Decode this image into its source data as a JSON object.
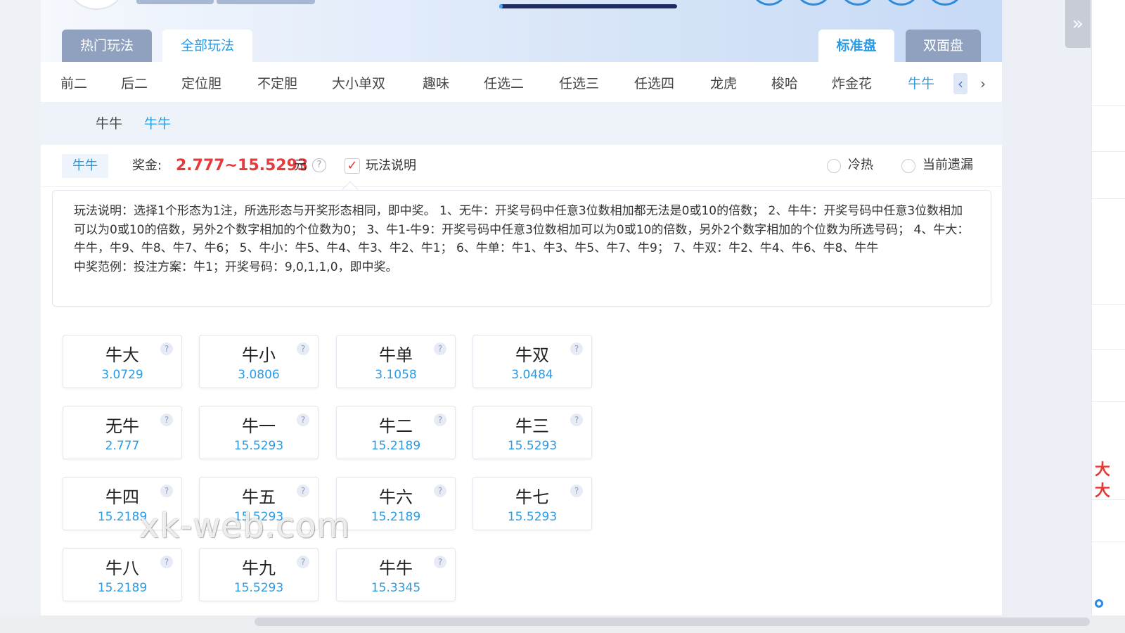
{
  "collapse_icon": "double-chevron-right-icon",
  "header": {
    "progress_fraction": 0.02
  },
  "tabs": {
    "left": [
      {
        "label": "热门玩法",
        "active": false
      },
      {
        "label": "全部玩法",
        "active": true
      }
    ],
    "right": [
      {
        "label": "标准盘",
        "active": true
      },
      {
        "label": "双面盘",
        "active": false
      }
    ]
  },
  "nav": {
    "items": [
      "前二",
      "后二",
      "定位胆",
      "不定胆",
      "大小单双",
      "趣味",
      "任选二",
      "任选三",
      "任选四",
      "龙虎",
      "梭哈",
      "炸金花",
      "牛牛"
    ],
    "active_index": 12,
    "prev_icon": "chevron-left-icon",
    "next_icon": "chevron-right-icon"
  },
  "subnav": {
    "group_label": "牛牛",
    "active_label": "牛牛"
  },
  "info": {
    "play_tag": "牛牛",
    "prize_label": "奖金:",
    "prize_value": "2.777~15.5293",
    "prize_unit": "元",
    "help_glyph": "?",
    "check_mark": "✓",
    "rules_label": "玩法说明",
    "rules_checked": true,
    "radio_hot_cold": "冷热",
    "radio_missing": "当前遗漏"
  },
  "description": {
    "text": "玩法说明：选择1个形态为1注，所选形态与开奖形态相同，即中奖。 1、无牛：开奖号码中任意3位数相加都无法是0或10的倍数； 2、牛牛：开奖号码中任意3位数相加可以为0或10的倍数，另外2个数字相加的个位数为0； 3、牛1-牛9：开奖号码中任意3位数相加可以为0或10的倍数，另外2个数字相加的个位数为所选号码； 4、牛大：牛牛，牛9、牛8、牛7、牛6； 5、牛小：牛5、牛4、牛3、牛2、牛1； 6、牛单：牛1、牛3、牛5、牛7、牛9； 7、牛双：牛2、牛4、牛6、牛8、牛牛",
    "example": "中奖范例：投注方案：牛1；开奖号码：9,0,1,1,0，即中奖。"
  },
  "bet_options": [
    {
      "name": "牛大",
      "odds": "3.0729"
    },
    {
      "name": "牛小",
      "odds": "3.0806"
    },
    {
      "name": "牛单",
      "odds": "3.1058"
    },
    {
      "name": "牛双",
      "odds": "3.0484"
    },
    {
      "name": "无牛",
      "odds": "2.777"
    },
    {
      "name": "牛一",
      "odds": "15.5293"
    },
    {
      "name": "牛二",
      "odds": "15.2189"
    },
    {
      "name": "牛三",
      "odds": "15.5293"
    },
    {
      "name": "牛四",
      "odds": "15.2189"
    },
    {
      "name": "牛五",
      "odds": "15.5293"
    },
    {
      "name": "牛六",
      "odds": "15.2189"
    },
    {
      "name": "牛七",
      "odds": "15.5293"
    },
    {
      "name": "牛八",
      "odds": "15.2189"
    },
    {
      "name": "牛九",
      "odds": "15.5293"
    },
    {
      "name": "牛牛",
      "odds": "15.3345"
    }
  ],
  "watermark": "xk-web.com",
  "edge_marks": [
    "大",
    "大"
  ]
}
